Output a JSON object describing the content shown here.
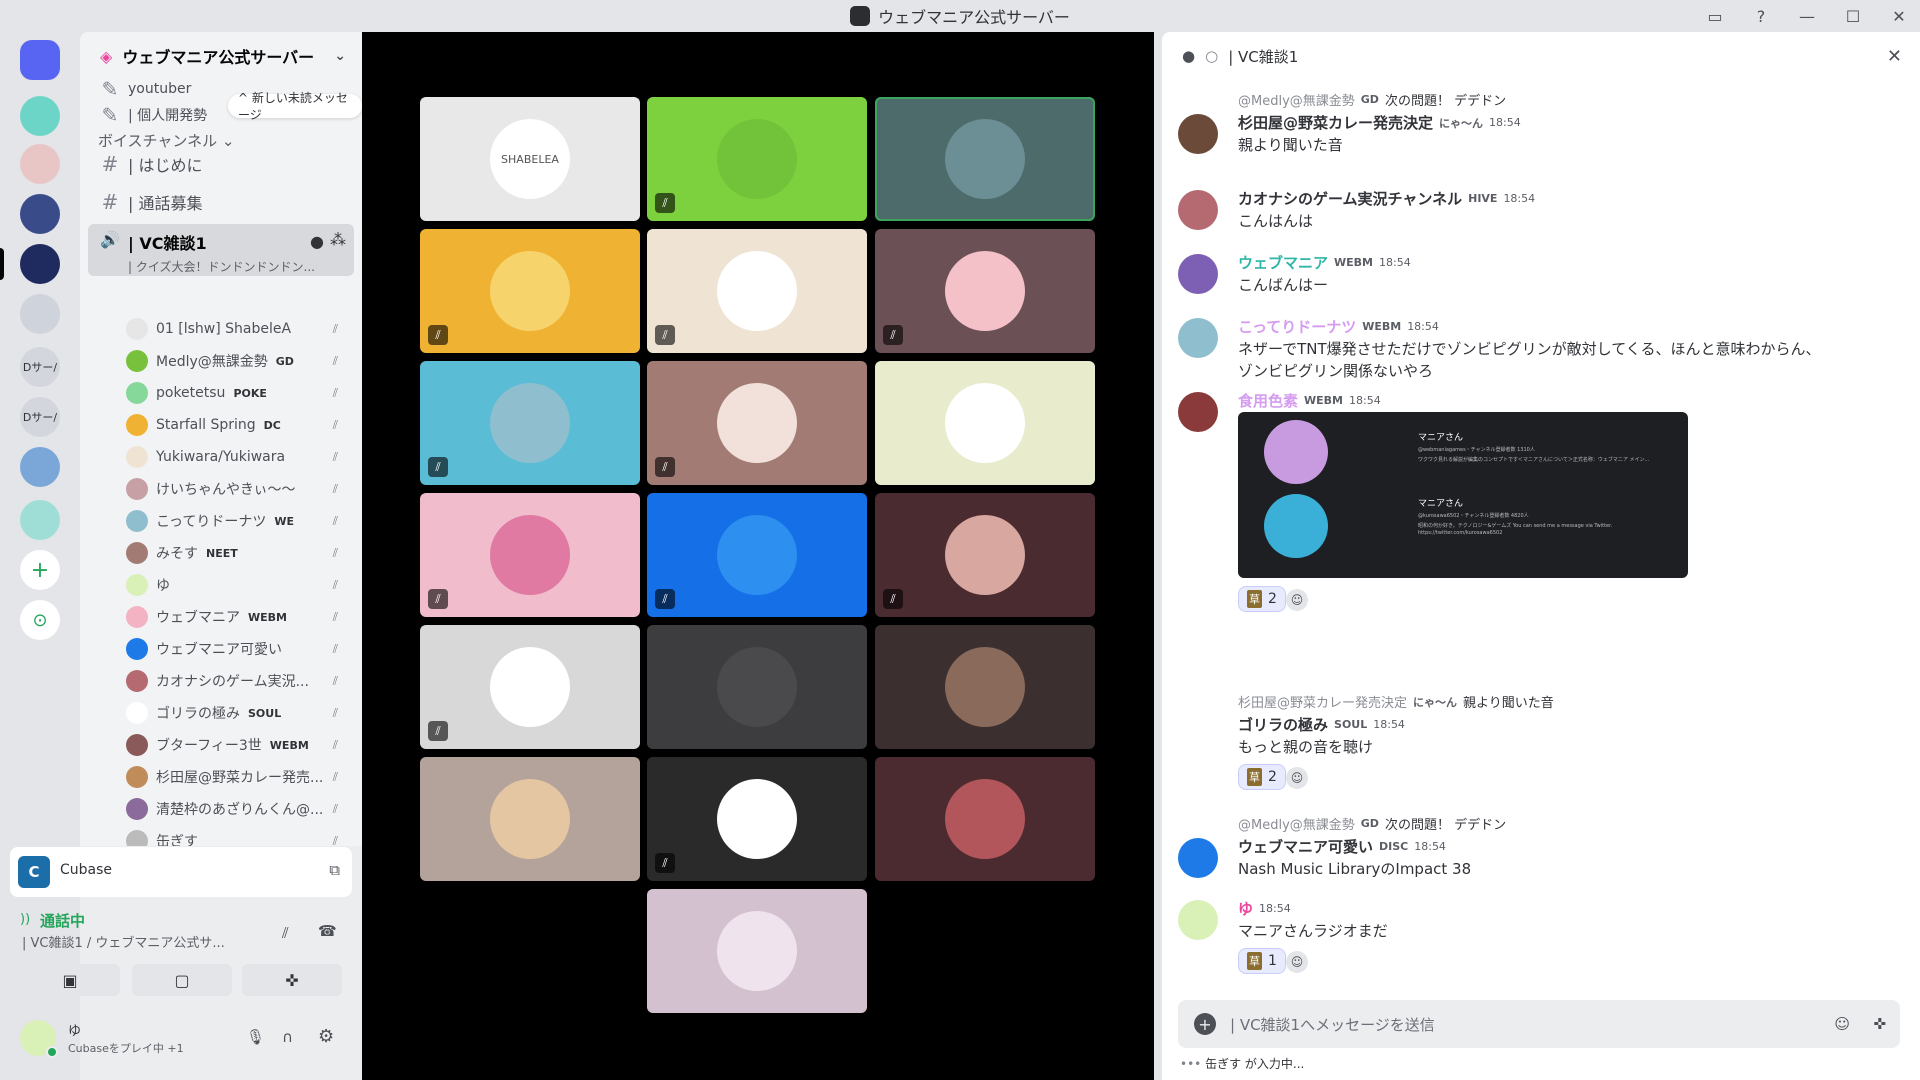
{
  "window": {
    "title": "ウェブマニア公式サーバー"
  },
  "rail": {
    "servers": [
      {
        "name": "discord-home",
        "color": "#5865f2",
        "label": ""
      },
      {
        "name": "server-1",
        "color": "#6dd5c8",
        "label": ""
      },
      {
        "name": "server-2",
        "color": "#e8c6c6",
        "label": ""
      },
      {
        "name": "server-3",
        "color": "#3a4b8a",
        "label": ""
      },
      {
        "name": "server-4",
        "color": "#1f2a5e",
        "label": ""
      },
      {
        "name": "server-5",
        "color": "#cfd3dc",
        "label": ""
      },
      {
        "name": "folder-1",
        "color": "#d3d6dc",
        "label": "Dサー/"
      },
      {
        "name": "folder-2",
        "color": "#d3d6dc",
        "label": "Dサー/"
      },
      {
        "name": "server-6",
        "color": "#7aa7d8",
        "label": ""
      },
      {
        "name": "server-7",
        "color": "#9fded6",
        "label": ""
      }
    ]
  },
  "sidebar": {
    "server_name": "ウェブマニア公式サーバー",
    "top_channels": [
      "youtuber",
      "| 個人開発勢"
    ],
    "unread_label": "^ 新しい未読メッセージ",
    "voice_category": "ボイスチャンネル",
    "channels": [
      {
        "label": "| はじめに"
      },
      {
        "label": "| 通話募集"
      }
    ],
    "voice_channel": "| VC雑談1",
    "voice_status": "| クイズ大会！ドンドンドンドン...",
    "voice_users": [
      {
        "name": "01 [lshw] ShabeleA",
        "tag": "",
        "color": "#e6e6e6"
      },
      {
        "name": "Medly@無課金勢",
        "tag": "GD",
        "color": "#78c13c"
      },
      {
        "name": "poketetsu",
        "tag": "POKE",
        "color": "#86d89a"
      },
      {
        "name": "Starfall Spring",
        "tag": "DC",
        "color": "#f0b232"
      },
      {
        "name": "Yukiwara/Yukiwara",
        "tag": "",
        "color": "#efe3d4"
      },
      {
        "name": "けいちゃんやきぃ～～",
        "tag": "",
        "color": "#c7a0a6"
      },
      {
        "name": "こってりドーナツ",
        "tag": "WE",
        "color": "#8fbfcf"
      },
      {
        "name": "みそす",
        "tag": "NEET",
        "color": "#a27c74"
      },
      {
        "name": "ゆ",
        "tag": "",
        "color": "#d9f0b7"
      },
      {
        "name": "ウェブマニア",
        "tag": "WEBM",
        "color": "#f4b3c2"
      },
      {
        "name": "ウェブマニア可愛い",
        "tag": "",
        "color": "#1d7ae6"
      },
      {
        "name": "カオナシのゲーム実況...",
        "tag": "",
        "color": "#b56a72"
      },
      {
        "name": "ゴリラの極み",
        "tag": "SOUL",
        "color": "#ffffff"
      },
      {
        "name": "ブターフィー3世",
        "tag": "WEBM",
        "color": "#8a5a5a"
      },
      {
        "name": "杉田屋@野菜カレー発売...",
        "tag": "",
        "color": "#c08c5a"
      },
      {
        "name": "清楚枠のあざりんくん@...",
        "tag": "",
        "color": "#8b6a9c"
      },
      {
        "name": "缶ぎす",
        "tag": "",
        "color": "#bbbbbb"
      }
    ],
    "activity": {
      "app": "Cubase"
    },
    "voice_panel": {
      "status": "通話中",
      "location": "| VC雑談1 / ウェブマニア公式サ..."
    },
    "user": {
      "name": "ゆ",
      "activity": "Cubaseをプレイ中 +1"
    }
  },
  "stage": {
    "tiles": [
      {
        "bg": "#e8e8e8",
        "avatar": "#ffffff",
        "label": "SHABELEA",
        "muted": false,
        "active": false
      },
      {
        "bg": "#7ed13e",
        "avatar": "#72c23a",
        "label": "",
        "muted": true,
        "active": false
      },
      {
        "bg": "#4e6b6b",
        "avatar": "#6b8f95",
        "label": "",
        "muted": false,
        "active": true
      },
      {
        "bg": "#f0b232",
        "avatar": "#f7d36b",
        "label": "",
        "muted": true,
        "active": false
      },
      {
        "bg": "#efe3d4",
        "avatar": "#ffffff",
        "label": "",
        "muted": true,
        "active": false
      },
      {
        "bg": "#6b5056",
        "avatar": "#f4c1c9",
        "label": "",
        "muted": true,
        "active": false
      },
      {
        "bg": "#5bbcd6",
        "avatar": "#8fbfcf",
        "label": "",
        "muted": true,
        "active": false
      },
      {
        "bg": "#a27c74",
        "avatar": "#f2e1da",
        "label": "",
        "muted": true,
        "active": false
      },
      {
        "bg": "#e8eccd",
        "avatar": "#ffffff",
        "label": "",
        "muted": false,
        "active": false
      },
      {
        "bg": "#f1bccb",
        "avatar": "#e07aa3",
        "label": "",
        "muted": true,
        "active": false
      },
      {
        "bg": "#1570e8",
        "avatar": "#2d8ff0",
        "label": "",
        "muted": true,
        "active": false
      },
      {
        "bg": "#4a2b30",
        "avatar": "#d7a7a0",
        "label": "",
        "muted": true,
        "active": false
      },
      {
        "bg": "#d8d8d8",
        "avatar": "#ffffff",
        "label": "",
        "muted": true,
        "active": false
      },
      {
        "bg": "#3d3d3f",
        "avatar": "#4a4a4d",
        "label": "",
        "muted": false,
        "active": false
      },
      {
        "bg": "#3b2f2f",
        "avatar": "#8a6a5a",
        "label": "",
        "muted": false,
        "active": false
      },
      {
        "bg": "#b3a39a",
        "avatar": "#e4c7a2",
        "label": "",
        "muted": false,
        "active": false
      },
      {
        "bg": "#2a2a2a",
        "avatar": "#ffffff",
        "label": "",
        "muted": true,
        "active": false
      },
      {
        "bg": "#4b2b30",
        "avatar": "#b3565c",
        "label": "",
        "muted": false,
        "active": false
      },
      {
        "bg": "#d4c1cf",
        "avatar": "#efe3ee",
        "label": "",
        "muted": false,
        "active": false
      }
    ]
  },
  "chat": {
    "channel": "| VC雑談1",
    "messages": [
      {
        "reply_user": "@Medly@無課金勢",
        "reply_tag": "GD",
        "reply_text": "次の問題！ デデドン",
        "name": "杉田屋@野菜カレー発売決定",
        "name_color": "#313338",
        "badge": "にゃ～ん",
        "time": "18:54",
        "text": "親より聞いた音",
        "avatar": "#6b4a3a"
      },
      {
        "name": "カオナシのゲーム実況チャンネル",
        "name_color": "#313338",
        "badge": "HIVE",
        "time": "18:54",
        "text": "こんはんは",
        "avatar": "#b56a72"
      },
      {
        "name": "ウェブマニア",
        "name_color": "#2fb6a8",
        "badge": "WEBM",
        "time": "18:54",
        "text": "こんばんはー",
        "avatar": "#7d5fb3"
      },
      {
        "name": "こってりドーナツ",
        "name_color": "#d59cf0",
        "badge": "WEBM",
        "time": "18:54",
        "text": "ネザーでTNT爆発させただけでゾンビピグリンが敵対してくる、ほんと意味わからん、",
        "text2": "ゾンビピグリン関係ないやろ",
        "avatar": "#8fbfcf"
      },
      {
        "name": "食用色素",
        "name_color": "#d59cf0",
        "badge": "WEBM",
        "time": "18:54",
        "text": "",
        "avatar": "#8a3a3a",
        "embed": {
          "title1": "マニアさん",
          "sub1": "@webmaniagames・チャンネル登録者数 1310人",
          "desc1": "ワクワク見れる解説が編集のコンセプトです＜マニアさんについて＞正式名称：ウェブマニア メイン...",
          "title2": "マニアさん",
          "sub2": "@kurosawa6502・チャンネル登録者数 4820人",
          "desc2": "昭和の何か好き。テクノロジー&ゲームズ You can send me a message via Twitter.",
          "link2": "https://twitter.com/kurosawa6502"
        },
        "reaction": "2"
      },
      {
        "reply_user": "杉田屋@野菜カレー発売決定",
        "reply_tag": "にゃ～ん",
        "reply_text": "親より聞いた音",
        "name": "ゴリラの極み",
        "name_color": "#313338",
        "badge": "SOUL",
        "time": "18:54",
        "text": "もっと親の音を聴け",
        "avatar": "#ffffff",
        "reaction": "2"
      },
      {
        "reply_user": "@Medly@無課金勢",
        "reply_tag": "GD",
        "reply_text": "次の問題！ デデドン",
        "name": "ウェブマニア可愛い",
        "name_color": "#313338",
        "badge": "DISC",
        "time": "18:54",
        "text": "Nash Music LibraryのImpact 38",
        "avatar": "#1d7ae6"
      },
      {
        "name": "ゆ",
        "name_color": "#eb459e",
        "badge": "",
        "time": "18:54",
        "text": "マニアさんラジオまだ",
        "avatar": "#d9f0b7",
        "reaction": "1"
      }
    ],
    "composer_placeholder": "| VC雑談1へメッセージを送信",
    "typing": "缶ぎす が入力中..."
  },
  "colors": {
    "accent": "#5865f2",
    "online": "#23a55a",
    "background_dark": "#000000"
  }
}
